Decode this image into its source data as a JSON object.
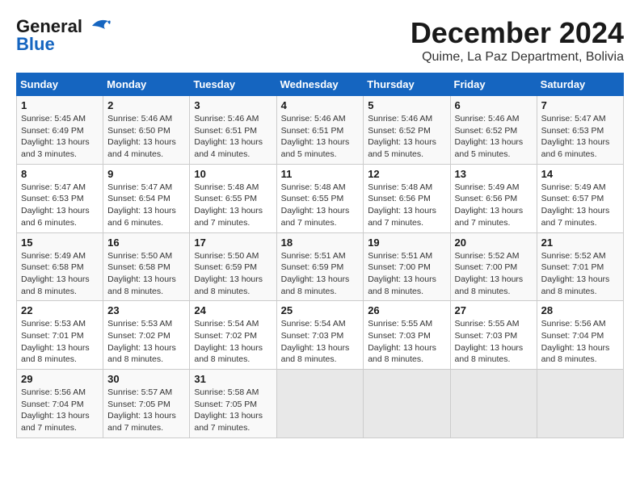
{
  "header": {
    "logo_line1": "General",
    "logo_line2": "Blue",
    "title": "December 2024",
    "subtitle": "Quime, La Paz Department, Bolivia"
  },
  "calendar": {
    "days_of_week": [
      "Sunday",
      "Monday",
      "Tuesday",
      "Wednesday",
      "Thursday",
      "Friday",
      "Saturday"
    ],
    "weeks": [
      [
        {
          "day": "1",
          "info": "Sunrise: 5:45 AM\nSunset: 6:49 PM\nDaylight: 13 hours\nand 3 minutes."
        },
        {
          "day": "2",
          "info": "Sunrise: 5:46 AM\nSunset: 6:50 PM\nDaylight: 13 hours\nand 4 minutes."
        },
        {
          "day": "3",
          "info": "Sunrise: 5:46 AM\nSunset: 6:51 PM\nDaylight: 13 hours\nand 4 minutes."
        },
        {
          "day": "4",
          "info": "Sunrise: 5:46 AM\nSunset: 6:51 PM\nDaylight: 13 hours\nand 5 minutes."
        },
        {
          "day": "5",
          "info": "Sunrise: 5:46 AM\nSunset: 6:52 PM\nDaylight: 13 hours\nand 5 minutes."
        },
        {
          "day": "6",
          "info": "Sunrise: 5:46 AM\nSunset: 6:52 PM\nDaylight: 13 hours\nand 5 minutes."
        },
        {
          "day": "7",
          "info": "Sunrise: 5:47 AM\nSunset: 6:53 PM\nDaylight: 13 hours\nand 6 minutes."
        }
      ],
      [
        {
          "day": "8",
          "info": "Sunrise: 5:47 AM\nSunset: 6:53 PM\nDaylight: 13 hours\nand 6 minutes."
        },
        {
          "day": "9",
          "info": "Sunrise: 5:47 AM\nSunset: 6:54 PM\nDaylight: 13 hours\nand 6 minutes."
        },
        {
          "day": "10",
          "info": "Sunrise: 5:48 AM\nSunset: 6:55 PM\nDaylight: 13 hours\nand 7 minutes."
        },
        {
          "day": "11",
          "info": "Sunrise: 5:48 AM\nSunset: 6:55 PM\nDaylight: 13 hours\nand 7 minutes."
        },
        {
          "day": "12",
          "info": "Sunrise: 5:48 AM\nSunset: 6:56 PM\nDaylight: 13 hours\nand 7 minutes."
        },
        {
          "day": "13",
          "info": "Sunrise: 5:49 AM\nSunset: 6:56 PM\nDaylight: 13 hours\nand 7 minutes."
        },
        {
          "day": "14",
          "info": "Sunrise: 5:49 AM\nSunset: 6:57 PM\nDaylight: 13 hours\nand 7 minutes."
        }
      ],
      [
        {
          "day": "15",
          "info": "Sunrise: 5:49 AM\nSunset: 6:58 PM\nDaylight: 13 hours\nand 8 minutes."
        },
        {
          "day": "16",
          "info": "Sunrise: 5:50 AM\nSunset: 6:58 PM\nDaylight: 13 hours\nand 8 minutes."
        },
        {
          "day": "17",
          "info": "Sunrise: 5:50 AM\nSunset: 6:59 PM\nDaylight: 13 hours\nand 8 minutes."
        },
        {
          "day": "18",
          "info": "Sunrise: 5:51 AM\nSunset: 6:59 PM\nDaylight: 13 hours\nand 8 minutes."
        },
        {
          "day": "19",
          "info": "Sunrise: 5:51 AM\nSunset: 7:00 PM\nDaylight: 13 hours\nand 8 minutes."
        },
        {
          "day": "20",
          "info": "Sunrise: 5:52 AM\nSunset: 7:00 PM\nDaylight: 13 hours\nand 8 minutes."
        },
        {
          "day": "21",
          "info": "Sunrise: 5:52 AM\nSunset: 7:01 PM\nDaylight: 13 hours\nand 8 minutes."
        }
      ],
      [
        {
          "day": "22",
          "info": "Sunrise: 5:53 AM\nSunset: 7:01 PM\nDaylight: 13 hours\nand 8 minutes."
        },
        {
          "day": "23",
          "info": "Sunrise: 5:53 AM\nSunset: 7:02 PM\nDaylight: 13 hours\nand 8 minutes."
        },
        {
          "day": "24",
          "info": "Sunrise: 5:54 AM\nSunset: 7:02 PM\nDaylight: 13 hours\nand 8 minutes."
        },
        {
          "day": "25",
          "info": "Sunrise: 5:54 AM\nSunset: 7:03 PM\nDaylight: 13 hours\nand 8 minutes."
        },
        {
          "day": "26",
          "info": "Sunrise: 5:55 AM\nSunset: 7:03 PM\nDaylight: 13 hours\nand 8 minutes."
        },
        {
          "day": "27",
          "info": "Sunrise: 5:55 AM\nSunset: 7:03 PM\nDaylight: 13 hours\nand 8 minutes."
        },
        {
          "day": "28",
          "info": "Sunrise: 5:56 AM\nSunset: 7:04 PM\nDaylight: 13 hours\nand 8 minutes."
        }
      ],
      [
        {
          "day": "29",
          "info": "Sunrise: 5:56 AM\nSunset: 7:04 PM\nDaylight: 13 hours\nand 7 minutes."
        },
        {
          "day": "30",
          "info": "Sunrise: 5:57 AM\nSunset: 7:05 PM\nDaylight: 13 hours\nand 7 minutes."
        },
        {
          "day": "31",
          "info": "Sunrise: 5:58 AM\nSunset: 7:05 PM\nDaylight: 13 hours\nand 7 minutes."
        },
        {
          "day": "",
          "info": ""
        },
        {
          "day": "",
          "info": ""
        },
        {
          "day": "",
          "info": ""
        },
        {
          "day": "",
          "info": ""
        }
      ]
    ]
  }
}
